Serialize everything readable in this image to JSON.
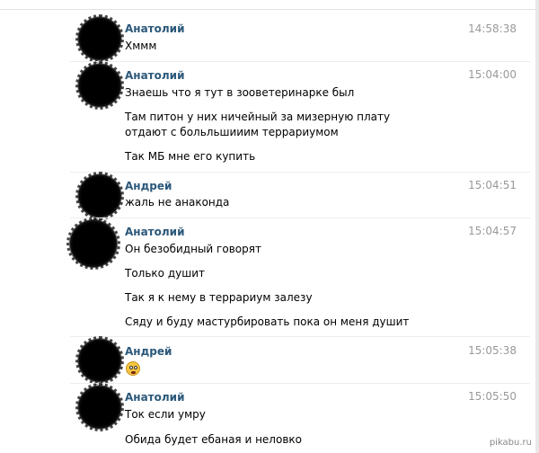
{
  "messages": [
    {
      "author": "Анатолий",
      "time": "14:58:38",
      "lines": [
        "Хммм"
      ]
    },
    {
      "author": "Анатолий",
      "time": "15:04:00",
      "lines": [
        "Знаешь что я тут в зооветеринарке был",
        "Там питон у них ничейный за мизерную плату отдают с больльшииим террариумом",
        "Так МБ мне его купить"
      ]
    },
    {
      "author": "Андрей",
      "time": "15:04:51",
      "lines": [
        "жаль не анаконда"
      ]
    },
    {
      "author": "Анатолий",
      "time": "15:04:57",
      "lines": [
        "Он безобидный говорят",
        "Только душит",
        "Так я к нему в террариум залезу",
        "Сяду и буду мастурбировать пока он меня душит"
      ]
    },
    {
      "author": "Андрей",
      "time": "15:05:38",
      "emoji": "scared-face-emoji"
    },
    {
      "author": "Анатолий",
      "time": "15:05:50",
      "lines": [
        "Ток если умру",
        "Обида будет ебаная и неловко"
      ]
    }
  ],
  "watermark": "pikabu.ru",
  "colors": {
    "author": "#2b587a",
    "time": "#999999",
    "separator": "#e9edf1"
  }
}
